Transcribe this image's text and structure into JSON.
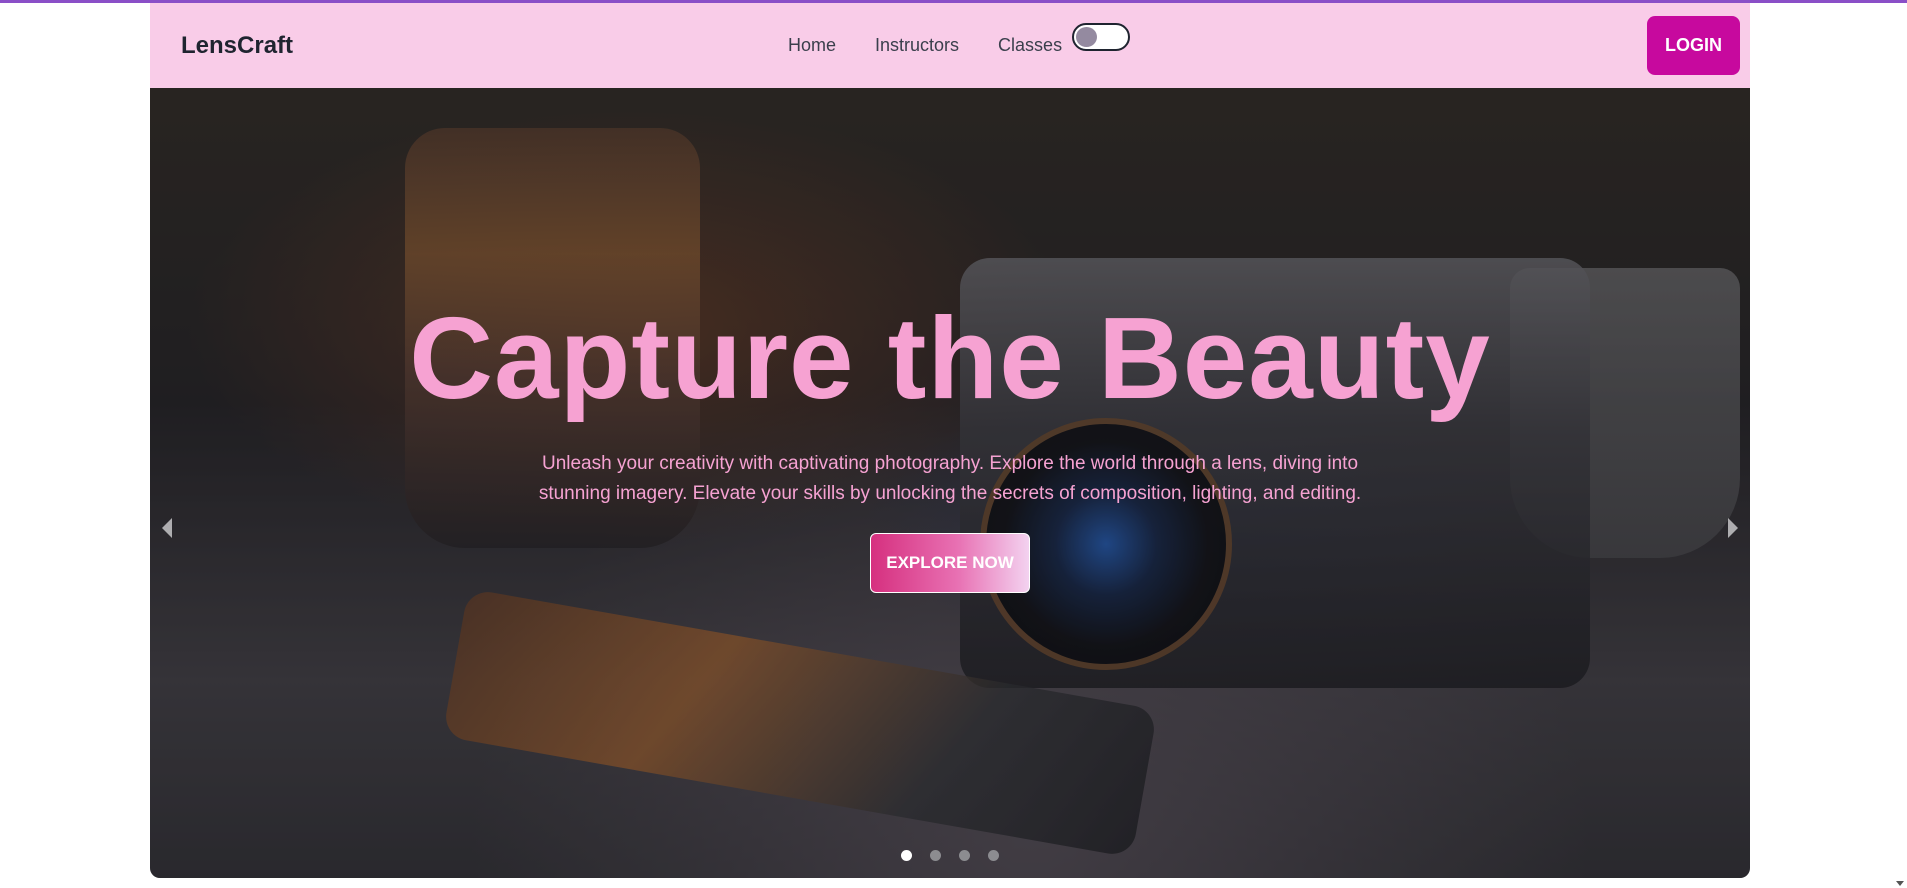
{
  "navbar": {
    "brand": "LensCraft",
    "links": [
      "Home",
      "Instructors",
      "Classes"
    ],
    "login_label": "LOGIN"
  },
  "hero": {
    "title": "Capture the Beauty",
    "text": "Unleash your creativity with captivating photography. Explore the world through a lens, diving into stunning imagery. Elevate your skills by unlocking the secrets of composition, lighting, and editing.",
    "cta_label": "EXPLORE NOW",
    "active_slide": 1,
    "slide_count": 4
  },
  "colors": {
    "navbar_bg": "#f9cce8",
    "accent": "#c7099e",
    "hero_text": "#f6a2d2"
  },
  "icons": {
    "prev": "chevron-left-icon",
    "next": "chevron-right-icon",
    "theme_toggle": "toggle-switch"
  }
}
